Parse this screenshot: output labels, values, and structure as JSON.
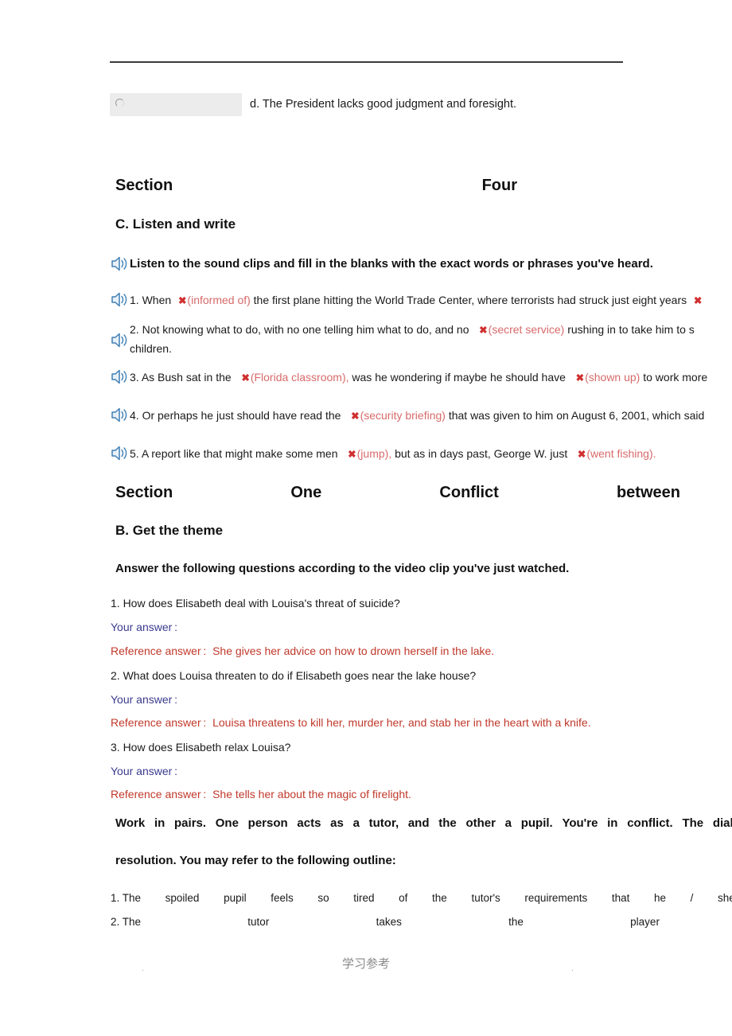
{
  "page": {
    "header_ghosts": [
      "..",
      "..",
      "..",
      ".."
    ],
    "option": {
      "text": "d. The President lacks good judgment and foresight.",
      "radio_name": "radio-unselected"
    }
  },
  "section_four": {
    "heading_words": [
      "Section",
      "Four"
    ],
    "subheading": "C. Listen and write",
    "instruction": "Listen to the sound clips and fill in the blanks with the exact words or phrases you've heard.",
    "items": [
      {
        "number": "1.",
        "pre": "When",
        "x": "✖",
        "blank": "(informed of)",
        "post": "the first plane hitting the World Trade Center, where terrorists had struck just eight years",
        "trailing_x": "✖",
        "line2": ""
      },
      {
        "number": "2.",
        "pre": "Not knowing what to do, with no one telling him what to do, and no",
        "x": "✖",
        "blank": "(secret service)",
        "post": "rushing in to take him to s",
        "trailing_x": "",
        "line2": "children."
      },
      {
        "number": "3.",
        "pre": "As Bush sat in the",
        "x": "✖",
        "blank": "(Florida classroom),",
        "post": "was he wondering if maybe he should have",
        "x2": "✖",
        "blank2": "(shown up)",
        "post2": "to work more",
        "line2": ""
      },
      {
        "number": "4.",
        "pre": "Or perhaps he just should have read the",
        "x": "✖",
        "blank": "(security briefing)",
        "post": "that was given to him on August 6, 2001, which said",
        "trailing_x": "",
        "line2": ""
      },
      {
        "number": "5.",
        "pre": "A report like that might make some men",
        "x": "✖",
        "blank": "(jump),",
        "post": "but as in days past, George W. just",
        "x2": "✖",
        "blank2": "(went fishing).",
        "post2": "",
        "line2": ""
      }
    ]
  },
  "section_one": {
    "heading_words": [
      "Section",
      "One",
      "Conflict",
      "between"
    ],
    "subheading": "B. Get the theme",
    "instruction": "Answer the following questions according to the video clip you've just watched.",
    "your_answer_label": "Your answer :",
    "reference_answer_label": "Reference answer :",
    "questions": [
      {
        "question": "1. How does Elisabeth deal with Louisa's threat of suicide?",
        "reference": "She gives her advice on how to drown herself in the lake."
      },
      {
        "question": "2. What does Louisa threaten to do if Elisabeth goes near the lake house?",
        "reference": "Louisa threatens to kill her, murder her, and stab her in the heart with a knife."
      },
      {
        "question": "3. How does Elisabeth relax Louisa?",
        "reference": "She tells her about the magic of firelight."
      }
    ],
    "pair_task_line1_words": [
      "Work",
      "in",
      "pairs.",
      "One",
      "person",
      "acts",
      "as",
      "a",
      "tutor,",
      "and",
      "the",
      "other",
      "a",
      "pupil.",
      "You're",
      "in",
      "conflict.",
      "The",
      "dialog"
    ],
    "pair_task_line2": "resolution. You may refer to the following outline:",
    "outline_rows": [
      [
        "1. The",
        "spoiled",
        "pupil",
        "feels",
        "so",
        "tired",
        "of",
        "the",
        "tutor's",
        "requirements",
        "that",
        "he",
        "/",
        "she"
      ],
      [
        "2. The",
        "tutor",
        "takes",
        "the",
        "player"
      ]
    ]
  },
  "footer": {
    "center_text": "学习参考",
    "left_dot": ".",
    "right_dot": "."
  }
}
